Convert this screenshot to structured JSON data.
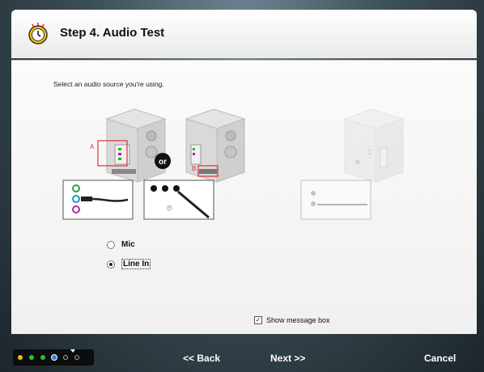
{
  "window": {
    "title": "Step 4. Audio Test"
  },
  "content": {
    "instruction": "Select an audio source you're using.",
    "diagram": {
      "label_a": "A",
      "label_b": "B",
      "label_c": "C",
      "label_or": "or"
    },
    "options": [
      {
        "label": "Mic",
        "selected": false
      },
      {
        "label": "Line In",
        "selected": true
      }
    ],
    "show_message_box": {
      "label": "Show message box",
      "checked": true
    }
  },
  "footer": {
    "back_label": "<< Back",
    "next_label": "Next >>",
    "cancel_label": "Cancel",
    "progress_dots": [
      {
        "color": "#e6c000"
      },
      {
        "color": "#22c43a"
      },
      {
        "color": "#22c43a"
      },
      {
        "color": "#2f7de0"
      },
      {
        "color": "#000000"
      },
      {
        "color": "#000000"
      }
    ],
    "current_step": 4
  }
}
